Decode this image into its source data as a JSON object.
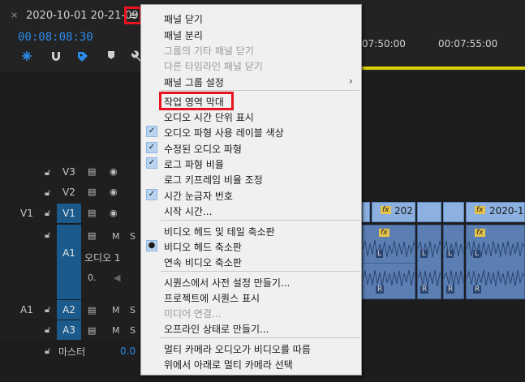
{
  "header": {
    "close_glyph": "×",
    "sequence_name": "2020-10-01 20-21-09",
    "menu_glyph": "≡",
    "timecode": "00:08:08:30",
    "ruler_labels": [
      "07:50:00",
      "00:07:55:00"
    ]
  },
  "tracks": {
    "video": [
      {
        "name": "V3",
        "eye": "◉"
      },
      {
        "name": "V2",
        "eye": "◉"
      },
      {
        "name": "V1",
        "source": "V1",
        "eye": "◉"
      }
    ],
    "audio": [
      {
        "name": "A1",
        "label": "오디오 1",
        "m": "M",
        "s": "S",
        "value": "0."
      },
      {
        "name": "A2",
        "source": "A1",
        "m": "M",
        "s": "S"
      },
      {
        "name": "A3",
        "m": "M",
        "s": "S"
      }
    ],
    "master": {
      "label": "마스터",
      "value": "0.0"
    }
  },
  "clips": {
    "fx_label": "fx",
    "clip_a": "202",
    "clip_b": "2020-1",
    "channel_left": "L",
    "channel_right": "R"
  },
  "menu": {
    "items": [
      {
        "label": "패널 닫기",
        "state": "normal"
      },
      {
        "label": "패널 분리",
        "state": "normal"
      },
      {
        "label": "그룹의 기타 패널 닫기",
        "state": "disabled"
      },
      {
        "label": "다른 타임라인 패널 닫기",
        "state": "disabled"
      },
      {
        "label": "패널 그룹 설정",
        "state": "submenu"
      },
      {
        "label": "작업 영역 막대",
        "state": "highlighted"
      },
      {
        "label": "오디오 시간 단위 표시",
        "state": "normal"
      },
      {
        "label": "오디오 파형 사용 레이블 색상",
        "state": "checked"
      },
      {
        "label": "수정된 오디오 파형",
        "state": "checked"
      },
      {
        "label": "로그 파형 비율",
        "state": "checked"
      },
      {
        "label": "로그 키프레임 비율 조정",
        "state": "normal"
      },
      {
        "label": "시간 눈금자 번호",
        "state": "checked"
      },
      {
        "label": "시작 시간...",
        "state": "normal"
      },
      {
        "label": "비디오 헤드 및 테일 축소판",
        "state": "normal"
      },
      {
        "label": "비디오 헤드 축소판",
        "state": "radio"
      },
      {
        "label": "연속 비디오 축소판",
        "state": "normal"
      },
      {
        "label": "시퀀스에서 사전 설정 만들기...",
        "state": "normal"
      },
      {
        "label": "프로젝트에 시퀀스 표시",
        "state": "normal"
      },
      {
        "label": "미디어 연결...",
        "state": "disabled"
      },
      {
        "label": "오프라인 상태로 만들기...",
        "state": "normal"
      },
      {
        "label": "멀티 카메라 오디오가 비디오를 따름",
        "state": "normal"
      },
      {
        "label": "위에서 아래로 멀티 카메라 선택",
        "state": "normal"
      }
    ],
    "check_glyph": "✓",
    "radio_glyph": "●",
    "submenu_glyph": "›"
  },
  "colors": {
    "accent_blue": "#2d8ceb",
    "highlight_red": "#e8131e",
    "work_area_yellow": "#dcd40b",
    "menu_background": "#f0f0f0"
  }
}
